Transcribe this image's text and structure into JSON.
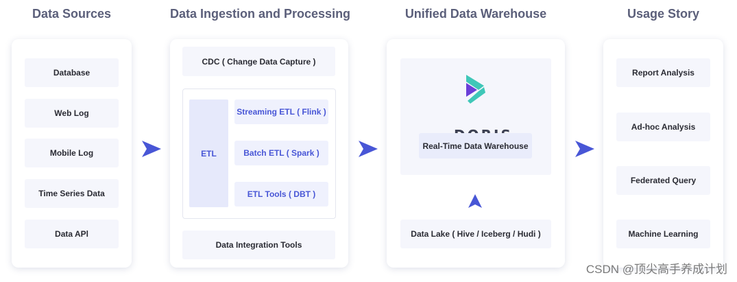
{
  "headings": {
    "sources": "Data Sources",
    "ingestion": "Data Ingestion and Processing",
    "warehouse": "Unified Data Warehouse",
    "usage": "Usage Story"
  },
  "sources": [
    "Database",
    "Web Log",
    "Mobile Log",
    "Time Series Data",
    "Data APl"
  ],
  "ingestion": {
    "cdc": "CDC ( Change Data Capture )",
    "etl": "ETL",
    "etl_items": [
      "Streaming ETL ( Flink )",
      "Batch ETL ( Spark )",
      "ETL Tools ( DBT )"
    ],
    "integration": "Data Integration Tools"
  },
  "warehouse": {
    "logo_text": "DORIS",
    "realtime": "Real-Time   Data Warehouse",
    "datalake": "Data Lake ( Hive / Iceberg / Hudi )"
  },
  "usage": [
    "Report Analysis",
    "Ad-hoc Analysis",
    "Federated Query",
    "Machine Learning"
  ],
  "watermark": "CSDN @顶尖高手养成计划",
  "colors": {
    "heading": "#5b5f7a",
    "accent": "#4856d6",
    "box": "#f5f6fc",
    "logo_teal": "#3fc7b8",
    "logo_purple": "#6a3fd8"
  }
}
